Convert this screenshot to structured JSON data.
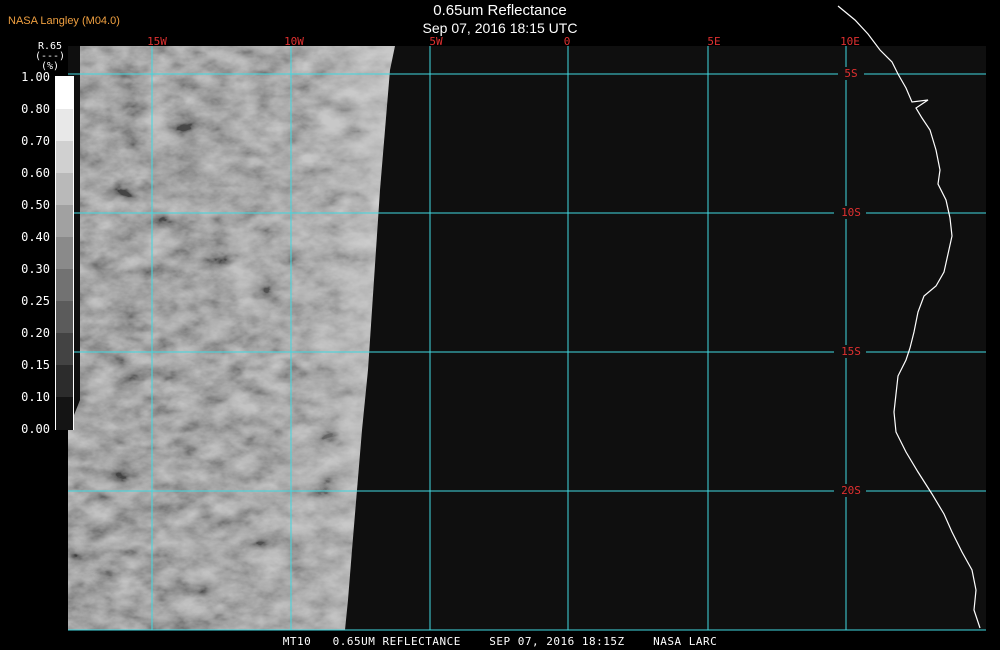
{
  "header": {
    "title": "0.65um Reflectance",
    "subtitle": "Sep 07, 2016 18:15 UTC",
    "credit": "NASA Langley (M04.0)"
  },
  "footer": {
    "text": "MT10   0.65UM REFLECTANCE    SEP 07, 2016 18:15Z    NASA LARC"
  },
  "legend": {
    "label": "R.65\n(---)\n(%)",
    "ticks": [
      "1.00",
      "0.80",
      "0.70",
      "0.60",
      "0.50",
      "0.40",
      "0.30",
      "0.25",
      "0.20",
      "0.15",
      "0.10",
      "0.00"
    ]
  },
  "map": {
    "lon_labels": [
      "15W",
      "10W",
      "5W",
      "0",
      "5E",
      "10E"
    ],
    "lat_labels": [
      "5S",
      "10S",
      "15S",
      "20S"
    ],
    "colors": {
      "grid": "#40d8e0",
      "labels": "#e03030",
      "coast": "#ffffff",
      "space": "#0f0f0f"
    }
  }
}
